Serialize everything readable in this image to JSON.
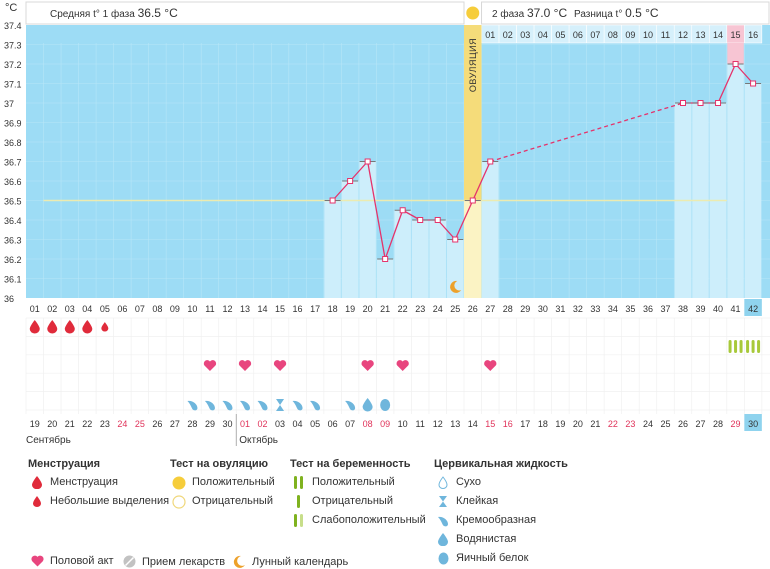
{
  "header": {
    "unit": "°C",
    "phase1_label": "Средняя t° 1 фаза",
    "phase1_value": "36.5 °C",
    "phase2_label": "2 фаза",
    "phase2_value": "37.0 °C",
    "diff_label": "Разница t°",
    "diff_value": "0.5 °C",
    "ovulation_label": "ОВУЛЯЦИЯ"
  },
  "chart_data": {
    "type": "line",
    "y_ticks": [
      "37.4",
      "37.3",
      "37.2",
      "37.1",
      "37",
      "36.9",
      "36.8",
      "36.7",
      "36.6",
      "36.5",
      "36.4",
      "36.3",
      "36.2",
      "36.1",
      "36"
    ],
    "ylim": [
      36,
      37.4
    ],
    "cycle_days": [
      "01",
      "02",
      "03",
      "04",
      "05",
      "06",
      "07",
      "08",
      "09",
      "10",
      "11",
      "12",
      "13",
      "14",
      "15",
      "16",
      "17",
      "18",
      "19",
      "20",
      "21",
      "22",
      "23",
      "24",
      "25",
      "26",
      "27",
      "28",
      "29",
      "30",
      "31",
      "32",
      "33",
      "34",
      "35",
      "36",
      "37",
      "38",
      "39",
      "40",
      "41",
      "42"
    ],
    "series": [
      {
        "values": [
          null,
          null,
          null,
          null,
          null,
          null,
          null,
          null,
          null,
          null,
          null,
          null,
          null,
          null,
          null,
          null,
          null,
          36.5,
          36.6,
          36.7,
          36.2,
          36.45,
          36.4,
          36.4,
          36.3,
          36.5,
          36.7,
          null,
          null,
          null,
          null,
          null,
          null,
          null,
          null,
          null,
          null,
          37.0,
          37.0,
          37.0,
          37.2,
          37.1
        ]
      }
    ],
    "coverline": 36.5,
    "ovulation_day": "26",
    "phase2_day_labels": [
      "01",
      "02",
      "03",
      "04",
      "05",
      "06",
      "07",
      "08",
      "09",
      "10",
      "11",
      "12",
      "13",
      "14",
      "15",
      "16"
    ],
    "calendar_dates": [
      "19",
      "20",
      "21",
      "22",
      "23",
      "24",
      "25",
      "26",
      "27",
      "28",
      "29",
      "30",
      "01",
      "02",
      "03",
      "04",
      "05",
      "06",
      "07",
      "08",
      "09",
      "10",
      "11",
      "12",
      "13",
      "14",
      "15",
      "16",
      "17",
      "18",
      "19",
      "20",
      "21",
      "22",
      "23",
      "24",
      "25",
      "26",
      "27",
      "28",
      "29",
      "30"
    ],
    "weekend_dates": [
      "24",
      "25",
      "01",
      "02",
      "08",
      "09",
      "15",
      "16",
      "22",
      "23",
      "29"
    ],
    "month_labels": [
      "Сентябрь",
      "Октябрь"
    ],
    "menstruation": [
      "full",
      "full",
      "full",
      "full",
      "light"
    ],
    "intercourse_days": [
      "11",
      "13",
      "15",
      "20",
      "22",
      "27"
    ],
    "pregnancy_test_days": [
      "41",
      "42"
    ],
    "cervical_fluid": [
      {
        "day": "10",
        "type": "cream"
      },
      {
        "day": "11",
        "type": "cream"
      },
      {
        "day": "12",
        "type": "cream"
      },
      {
        "day": "13",
        "type": "cream"
      },
      {
        "day": "14",
        "type": "cream"
      },
      {
        "day": "15",
        "type": "sticky"
      },
      {
        "day": "16",
        "type": "cream"
      },
      {
        "day": "17",
        "type": "cream"
      },
      {
        "day": "19",
        "type": "cream"
      },
      {
        "day": "20",
        "type": "watery"
      },
      {
        "day": "21",
        "type": "eggwhite"
      }
    ],
    "moon_day": "25",
    "colors": {
      "bar": "#cdeefb",
      "bg": "#9ddcf5",
      "line": "#e5336b",
      "ovulation": "#f5dc7a",
      "coverline": "#ecebb0",
      "pink_bar": "#f7c5d3",
      "weekend": "#e0335a"
    }
  },
  "legend": {
    "menstruation_title": "Менструация",
    "menstruation_items": [
      "Менструация",
      "Небольшие выделения"
    ],
    "ovulation_title": "Тест на овуляцию",
    "ovulation_items": [
      "Положительный",
      "Отрицательный"
    ],
    "pregnancy_title": "Тест на беременность",
    "pregnancy_items": [
      "Положительный",
      "Отрицательный",
      "Слабоположительный"
    ],
    "fluid_title": "Цервикальная жидкость",
    "fluid_items": [
      "Сухо",
      "Клейкая",
      "Кремообразная",
      "Водянистая",
      "Яичный белок"
    ],
    "bottom_items": [
      "Половой акт",
      "Прием лекарств",
      "Лунный календарь"
    ]
  }
}
